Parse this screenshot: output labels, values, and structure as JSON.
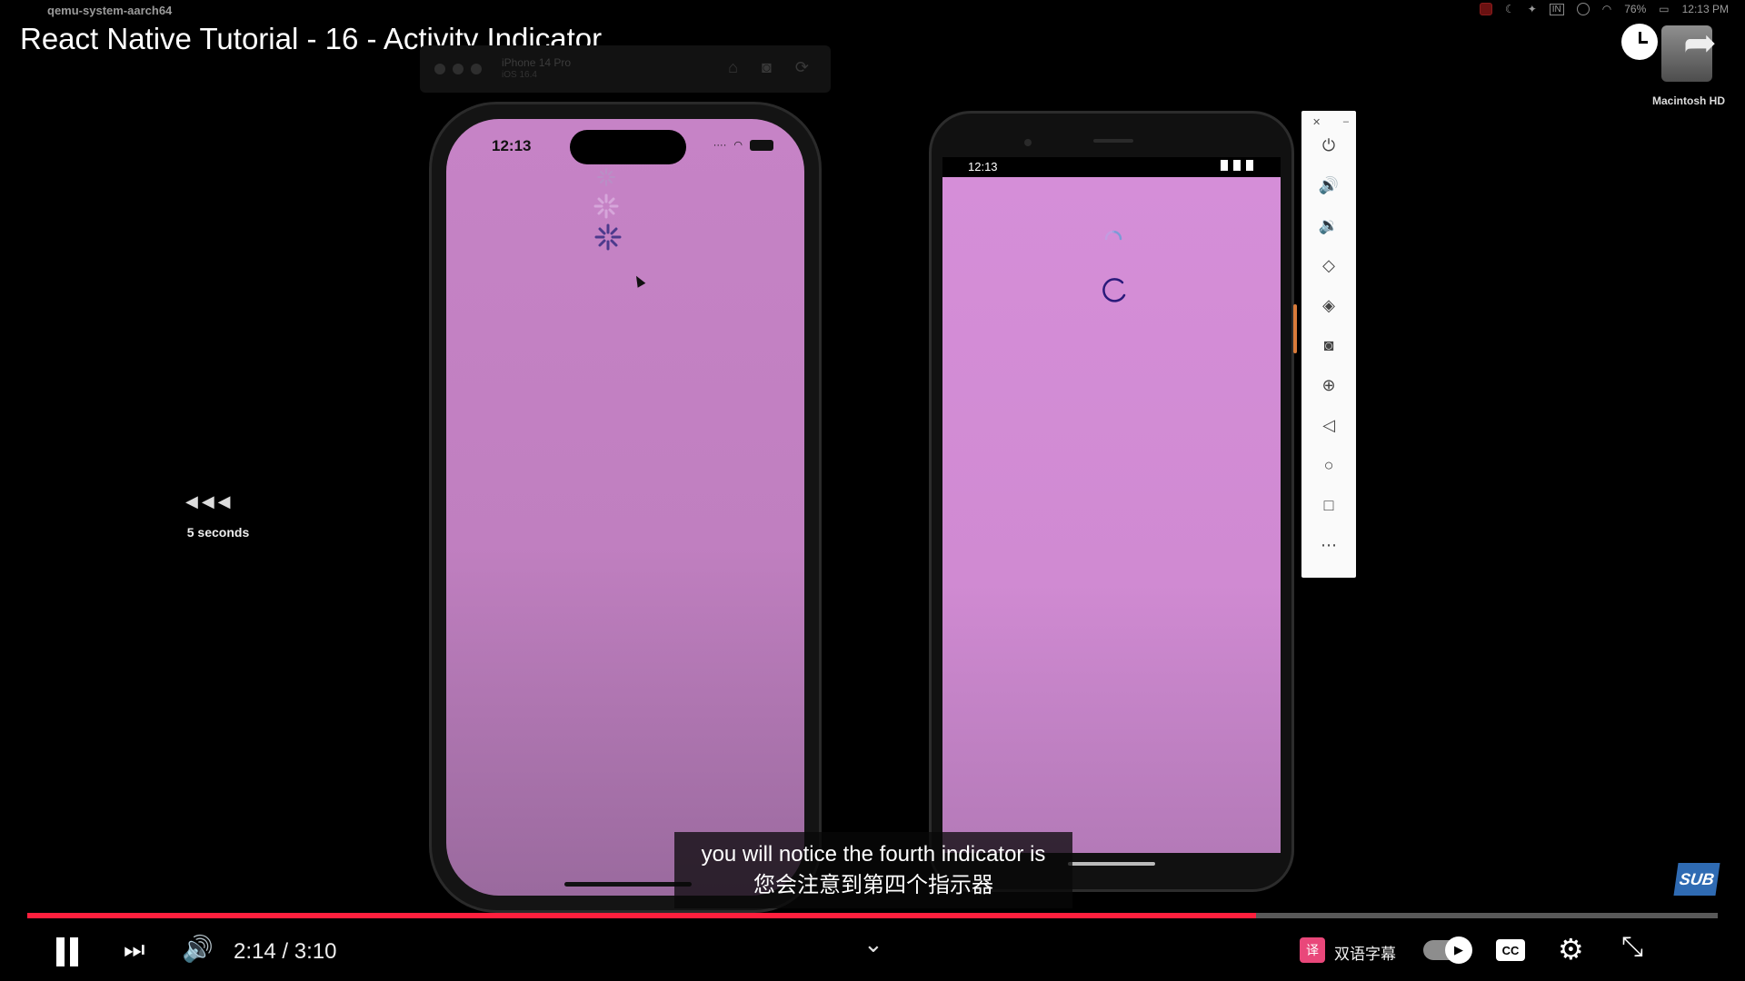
{
  "menubar": {
    "apple": "",
    "app_name": "qemu-system-aarch64",
    "right": {
      "keyboard": "IN",
      "battery": "76%",
      "time": "12:13 PM"
    }
  },
  "video": {
    "title": "React Native Tutorial - 16 - Activity Indicator",
    "rewind_label": "5 seconds",
    "caption_en": "you will notice the fourth indicator is",
    "caption_zh": "您会注意到第四个指示器",
    "sub_badge": "SUB"
  },
  "desktop": {
    "disk_label": "Macintosh HD"
  },
  "ios_sim": {
    "device_name": "iPhone 14 Pro",
    "os_version": "iOS 16.4",
    "status_time": "12:13"
  },
  "android": {
    "status_time": "12:13"
  },
  "player": {
    "time_display": "2:14 / 3:10",
    "progress": 0.727,
    "translate_label": "双语字幕",
    "cc_label": "CC"
  },
  "colors": {
    "accent": "#ff1f3d",
    "ios_bg": "#c683c6",
    "android_bg": "#d58ed8",
    "spinner_ios": "#4b3a8c",
    "spinner_android": "#2a1a7a"
  }
}
